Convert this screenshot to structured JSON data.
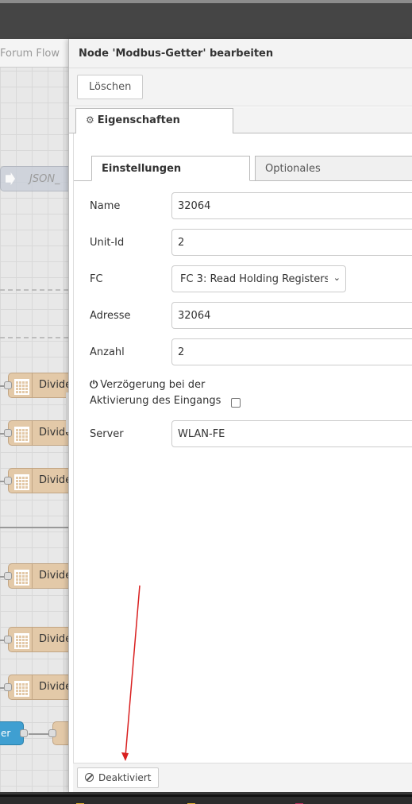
{
  "canvas": {
    "tab_label": "Forum Flow",
    "json_node_label": "JSON_",
    "divider_labels": [
      "Divide",
      "Divide",
      "Divide",
      "Divide",
      "Divide",
      "Divide"
    ],
    "blue_node_label": "er"
  },
  "editor": {
    "title": "Node 'Modbus-Getter' bearbeiten",
    "delete_label": "Löschen",
    "tab_properties": "Eigenschaften",
    "subtab_settings": "Einstellungen",
    "subtab_optional": "Optionales",
    "fields": {
      "name_label": "Name",
      "name_value": "32064",
      "unitid_label": "Unit-Id",
      "unitid_value": "2",
      "fc_label": "FC",
      "fc_value": "FC 3: Read Holding Registers",
      "address_label": "Adresse",
      "address_value": "32064",
      "count_label": "Anzahl",
      "count_value": "2",
      "delay_label_line1": "Verzögerung bei der",
      "delay_label_line2": "Aktivierung des Eingangs",
      "server_label": "Server",
      "server_value": "WLAN-FE"
    },
    "footer_button": "Deaktiviert"
  },
  "colors": {
    "annotation_arrow": "#d92020",
    "function_node": "#e3c9a8",
    "inject_node": "#3f9fd1"
  },
  "icons": [
    "gear-icon",
    "power-icon",
    "ban-icon",
    "calculator-icon",
    "arrow-right-icon"
  ]
}
